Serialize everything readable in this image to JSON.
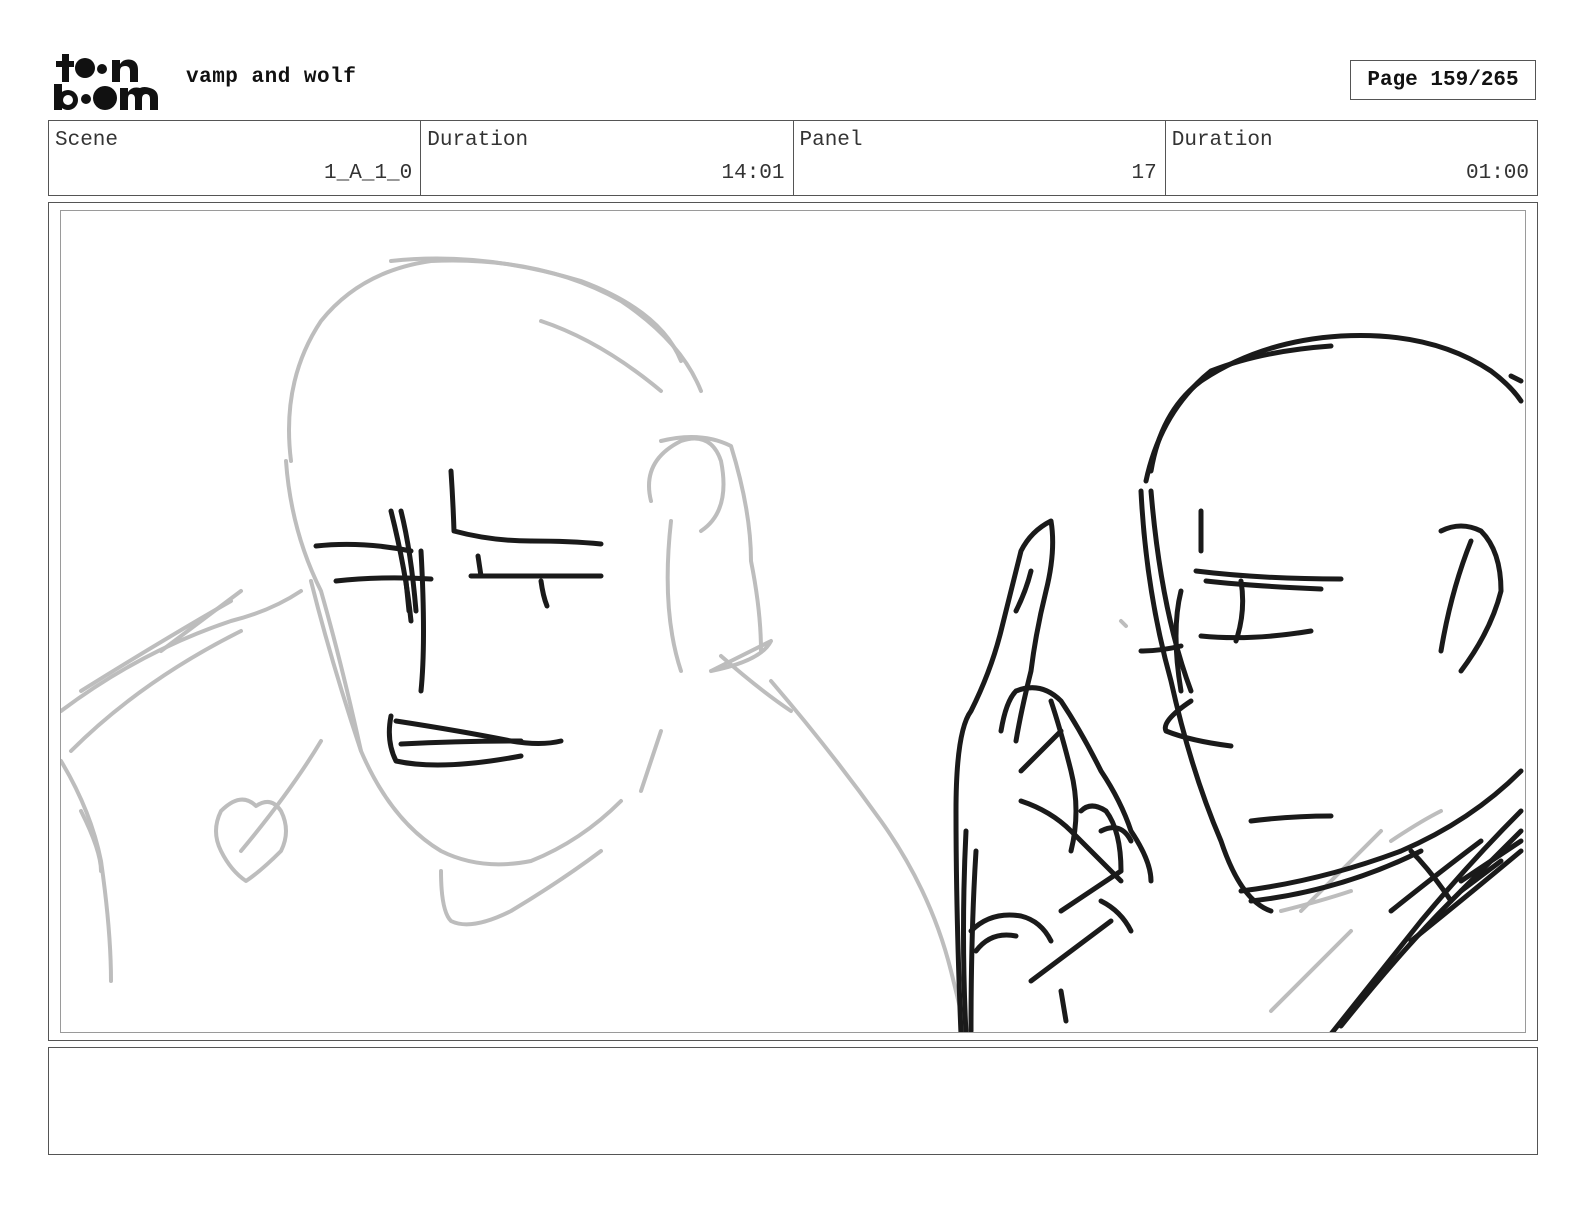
{
  "header": {
    "logo_text": "toon boom",
    "project_title": "vamp and wolf",
    "page_label": "Page",
    "page_current": "159",
    "page_total": "265"
  },
  "info": {
    "scene_label": "Scene",
    "scene_value": "1_A_1_0",
    "scene_duration_label": "Duration",
    "scene_duration_value": "14:01",
    "panel_label": "Panel",
    "panel_value": "17",
    "panel_duration_label": "Duration",
    "panel_duration_value": "01:00"
  },
  "notes": {
    "text": ""
  },
  "colors": {
    "ink": "#1a1a1a",
    "rough": "#bdbdbd",
    "border": "#555555"
  }
}
